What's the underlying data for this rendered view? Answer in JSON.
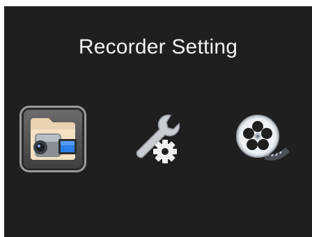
{
  "screen": {
    "title": "Recorder Setting"
  },
  "menu": {
    "selected_index": 0,
    "items": [
      {
        "icon": "camcorder-folder-icon",
        "selected": true
      },
      {
        "icon": "wrench-gear-icon",
        "selected": false
      },
      {
        "icon": "film-reel-icon",
        "selected": false
      }
    ]
  },
  "colors": {
    "background": "#1f1f1f",
    "title_text": "#f2f2f2",
    "selector": "#5a5a5a"
  }
}
